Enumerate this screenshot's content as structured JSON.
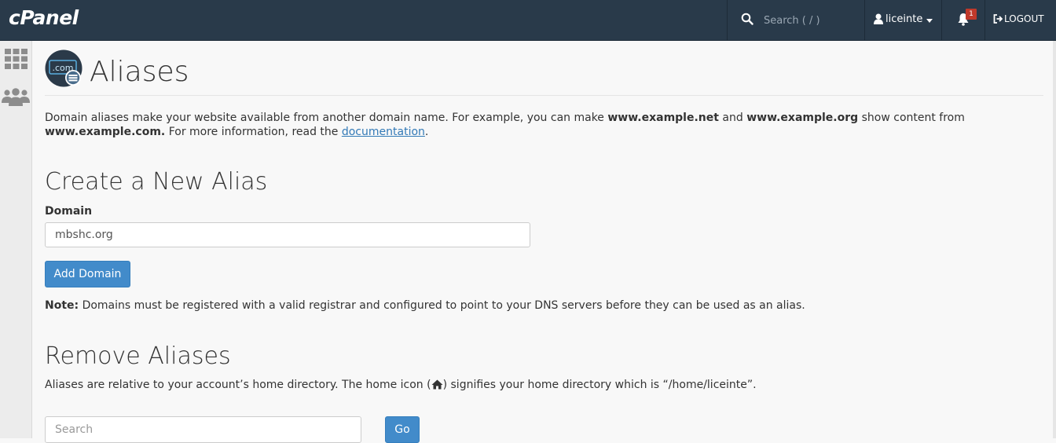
{
  "header": {
    "logo": "cPanel",
    "search_placeholder": "Search ( / )",
    "username": "liceinte",
    "notification_count": "1",
    "logout_label": "LOGOUT"
  },
  "sidebar": {
    "items": [
      {
        "icon": "grid-icon"
      },
      {
        "icon": "users-icon"
      }
    ]
  },
  "page": {
    "title": "Aliases",
    "intro": {
      "part1": "Domain aliases make your website available from another domain name. For example, you can make ",
      "bold1": "www.example.net",
      "part2": " and ",
      "bold2": "www.example.org",
      "part3": " show content from ",
      "bold3": "www.example.com.",
      "part4": " For more information, read the ",
      "link": "documentation",
      "part5": "."
    }
  },
  "create": {
    "heading": "Create a New Alias",
    "domain_label": "Domain",
    "domain_value": "mbshc.org",
    "add_button": "Add Domain",
    "note_label": "Note:",
    "note_text": " Domains must be registered with a valid registrar and configured to point to your DNS servers before they can be used as an alias."
  },
  "remove": {
    "heading": "Remove Aliases",
    "desc_part1": "Aliases are relative to your account’s home directory. The home icon (",
    "desc_part2": ") signifies your home directory which is “/home/liceinte”.",
    "search_placeholder": "Search",
    "go_button": "Go"
  }
}
